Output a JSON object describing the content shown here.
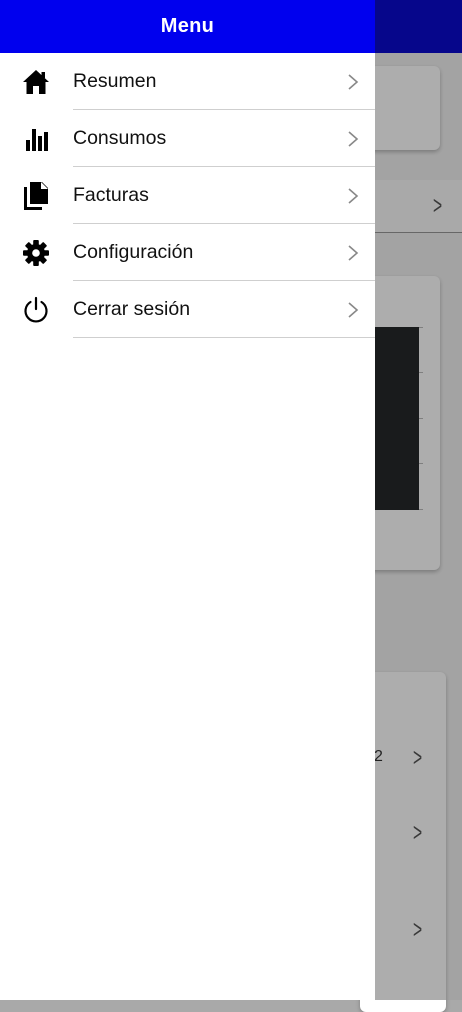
{
  "drawer": {
    "title": "Menu",
    "items": [
      {
        "label": "Resumen",
        "icon": "home-icon"
      },
      {
        "label": "Consumos",
        "icon": "bar-chart-icon"
      },
      {
        "label": "Facturas",
        "icon": "documents-icon"
      },
      {
        "label": "Configuración",
        "icon": "gear-icon"
      },
      {
        "label": "Cerrar sesión",
        "icon": "power-icon"
      }
    ]
  },
  "background": {
    "partial_text": "2"
  },
  "colors": {
    "drawer_header": "#0000ee",
    "app_header": "#0a0acd",
    "drawer_bg": "#ffffff",
    "text": "#111111"
  }
}
